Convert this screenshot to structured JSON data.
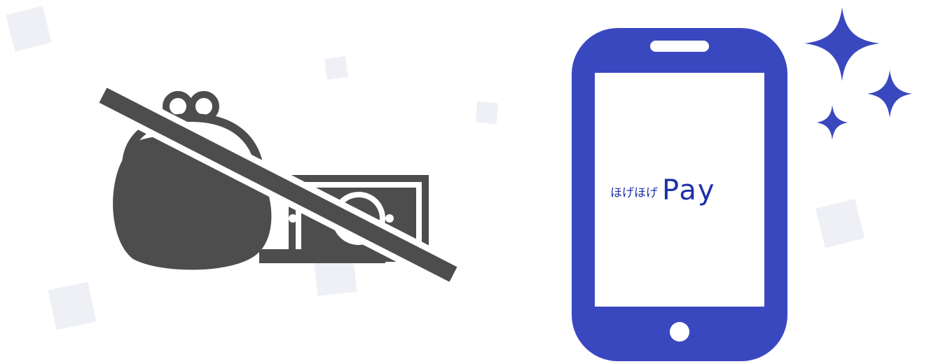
{
  "logo": {
    "jp_text": "ほげほげ",
    "pay_text": "Pay"
  },
  "colors": {
    "phone_blue": "#3a48bf",
    "icon_gray": "#4d4d4d",
    "deco_square": "#eef0f6",
    "sparkle": "#3a48bf",
    "logo_text": "#1e2fa8"
  },
  "icons": {
    "left": "no-cash-purse-icon",
    "right": "smartphone-icon",
    "sparkles": "sparkle-icon"
  }
}
